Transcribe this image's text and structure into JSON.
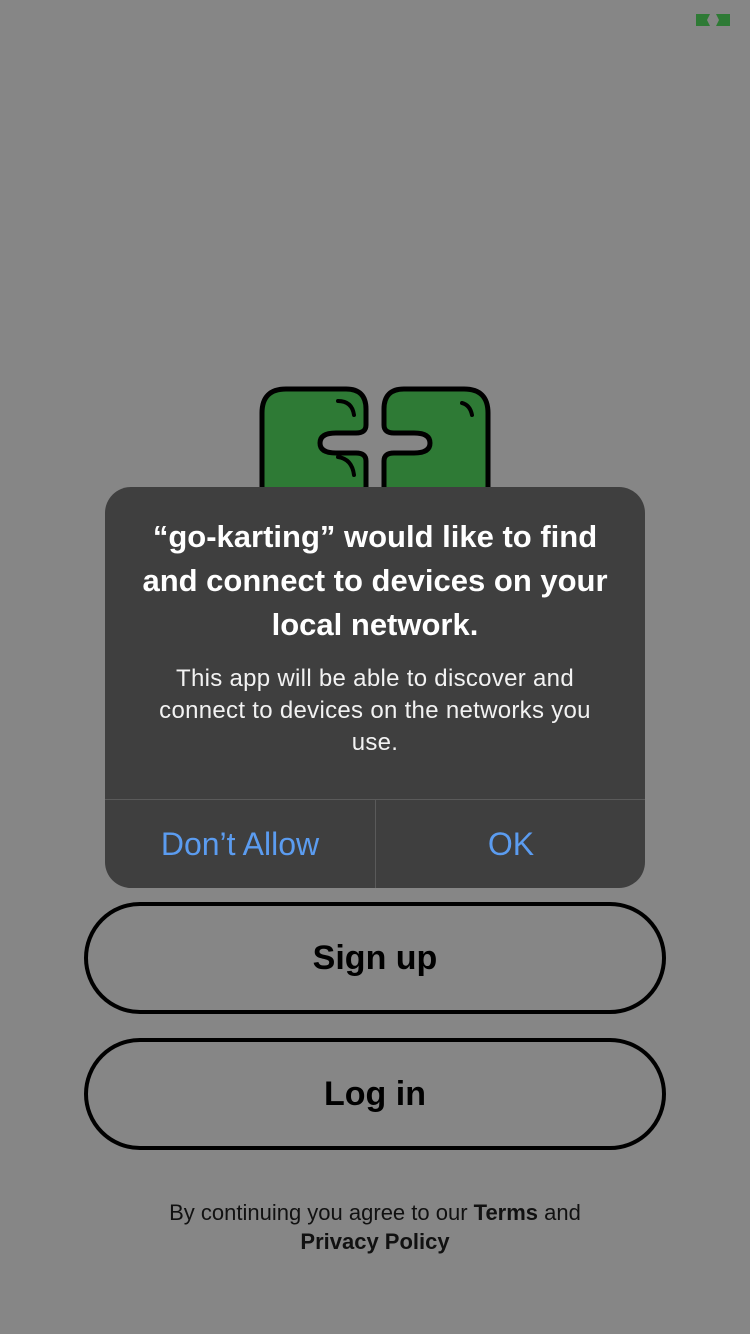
{
  "colors": {
    "background": "#868686",
    "brand_green": "#2e7a35",
    "alert_background": "#3f3f3f",
    "alert_button": "#5b9cf0"
  },
  "icons": {
    "corner": "app-logo-icon",
    "main": "app-logo-icon"
  },
  "alert": {
    "title": "“go-karting” would like to find and connect to devices on your local network.",
    "message": "This app will be able to discover and connect to devices on the networks you use.",
    "deny_label": "Don’t Allow",
    "ok_label": "OK"
  },
  "buttons": {
    "signup_label": "Sign up",
    "login_label": "Log in"
  },
  "legal": {
    "prefix": "By continuing you agree to our ",
    "terms": "Terms",
    "conjunction": " and",
    "privacy": "Privacy Policy"
  }
}
